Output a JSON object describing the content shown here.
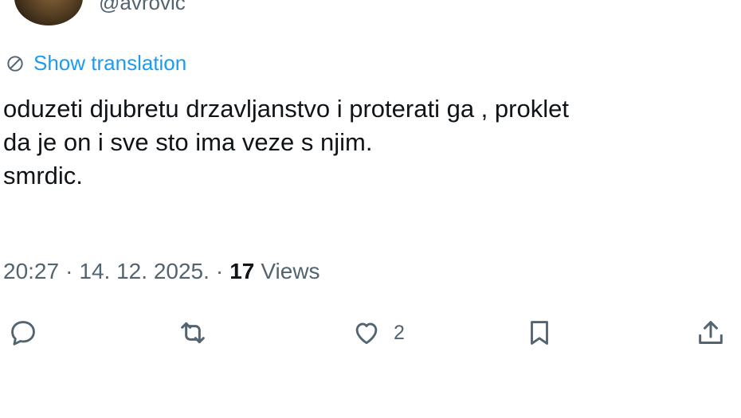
{
  "author": {
    "handle": "@avrovic"
  },
  "translation": {
    "label": "Show translation",
    "icon": "globe-icon"
  },
  "tweet": {
    "lines": [
      "oduzeti djubretu drzavljanstvo i proterati ga , proklet",
      "da je on i sve sto ima veze s njim.",
      "smrdic."
    ]
  },
  "meta": {
    "time": "20:27",
    "separator": "·",
    "date": "14. 12. 2025.",
    "views_count": "17",
    "views_label": "Views"
  },
  "actions": {
    "reply": {
      "icon": "reply-icon"
    },
    "retweet": {
      "icon": "retweet-icon"
    },
    "like": {
      "icon": "heart-icon",
      "count": "2"
    },
    "bookmark": {
      "icon": "bookmark-icon"
    },
    "share": {
      "icon": "share-icon"
    }
  },
  "colors": {
    "link": "#1d9bf0",
    "text": "#0f1419",
    "muted": "#536471"
  }
}
